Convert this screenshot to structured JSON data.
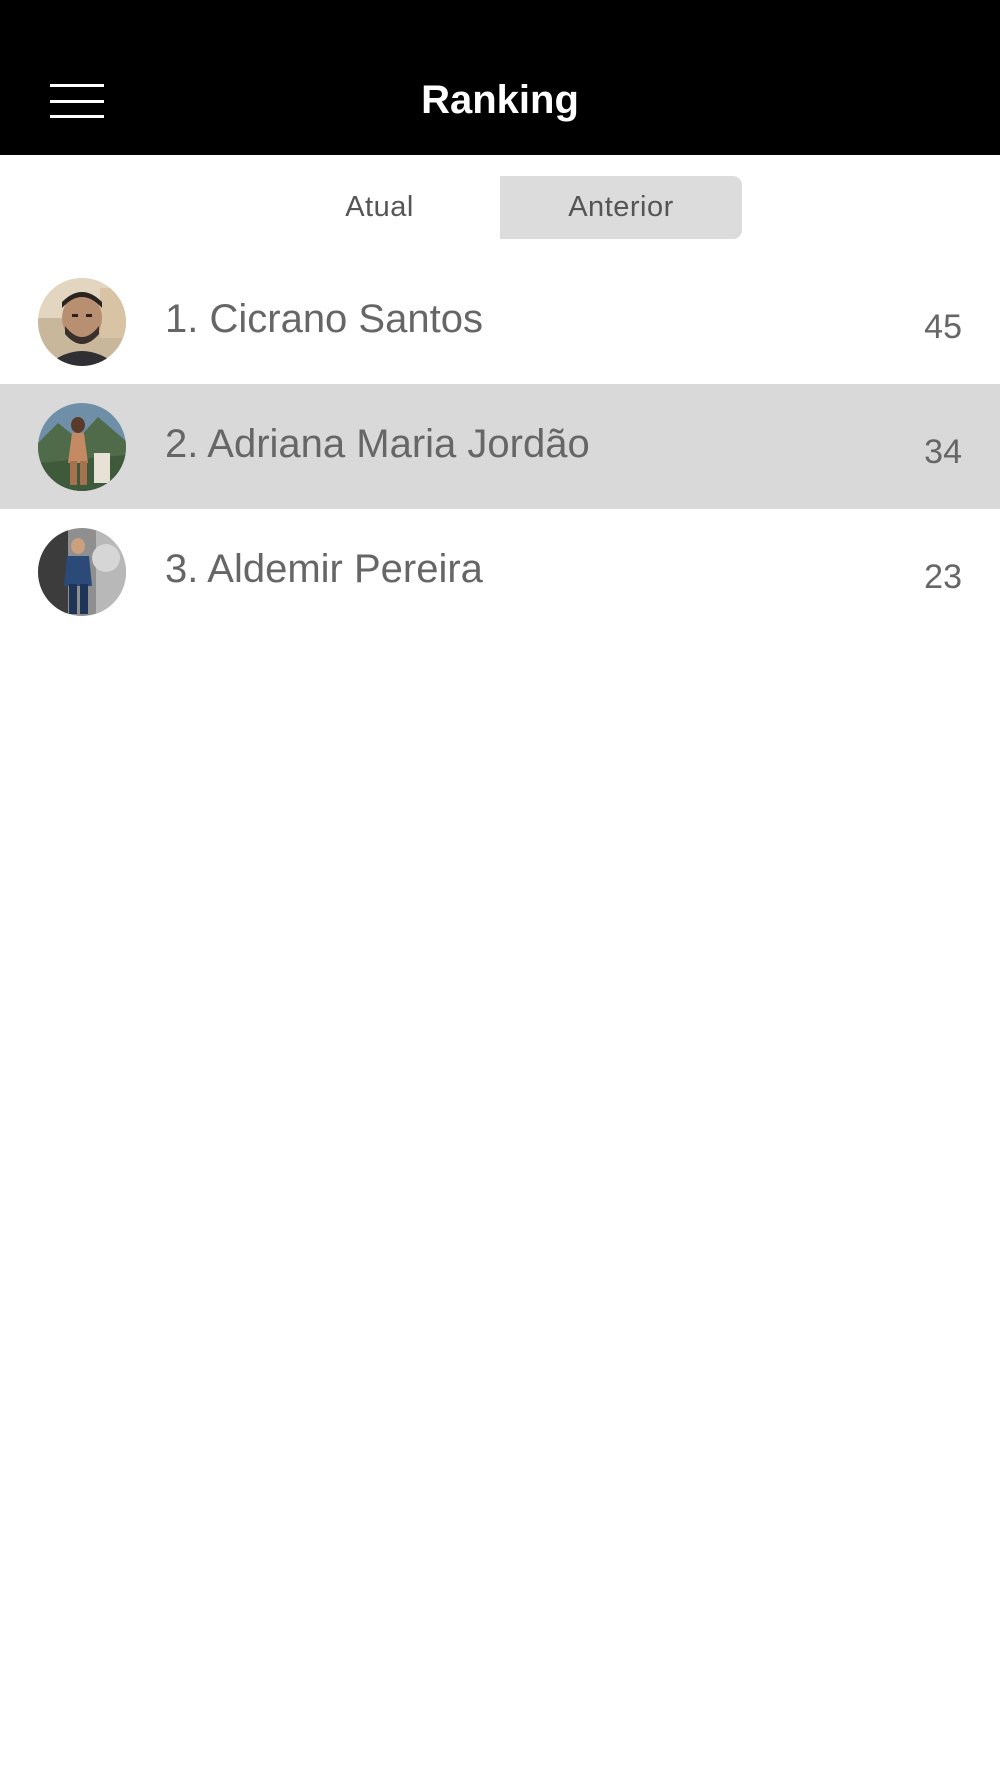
{
  "header": {
    "title": "Ranking",
    "menu_icon": "hamburger-menu-icon",
    "background": "#000000",
    "text_color": "#ffffff"
  },
  "tabs": [
    {
      "label": "Atual",
      "selected": false
    },
    {
      "label": "Anterior",
      "selected": true
    }
  ],
  "ranking": [
    {
      "name": "1. Cicrano Santos",
      "score": "45",
      "selected": false
    },
    {
      "name": "2. Adriana Maria Jordão",
      "score": "34",
      "selected": true
    },
    {
      "name": "3. Aldemir Pereira",
      "score": "23",
      "selected": false
    }
  ],
  "colors": {
    "selected_row": "#d9d9d9",
    "selected_tab": "#dcdcdc",
    "text": "#666666"
  }
}
